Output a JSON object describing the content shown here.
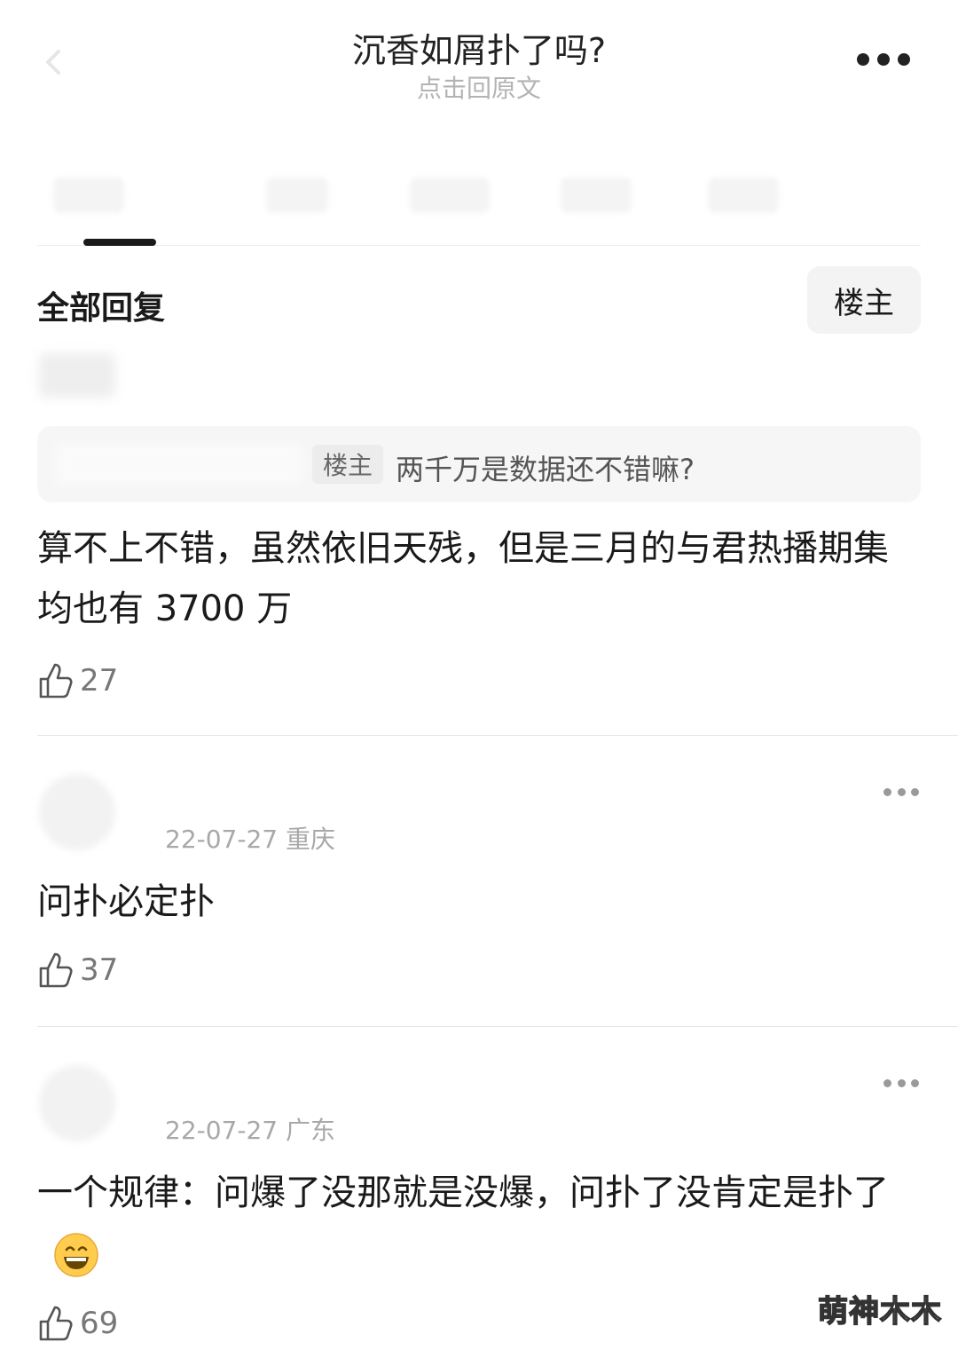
{
  "header": {
    "title": "沉香如屑扑了吗?",
    "subtitle": "点击回原文",
    "icons": {
      "back": "chevron-left-icon",
      "more": "more-horizontal-icon"
    }
  },
  "filter": {
    "title": "全部回复",
    "op_button": "楼主"
  },
  "quote": {
    "badge": "楼主",
    "text": "两千万是数据还不错嘛?"
  },
  "replies": [
    {
      "content": "算不上不错，虽然依旧天残，但是三月的与君热播期集均也有 3700 万",
      "likes": "27"
    },
    {
      "date_location": "22-07-27 重庆",
      "content": "问扑必定扑",
      "likes": "37"
    },
    {
      "date_location": "22-07-27 广东",
      "content": "一个规律：问爆了没那就是没爆，问扑了没肯定是扑了",
      "likes": "69"
    }
  ],
  "watermark": "萌神木木",
  "colors": {
    "text": "#1a1a1a",
    "muted": "#a8a8a8",
    "divider": "#e5e5e5",
    "emoji_face": "#ffcc4d"
  }
}
